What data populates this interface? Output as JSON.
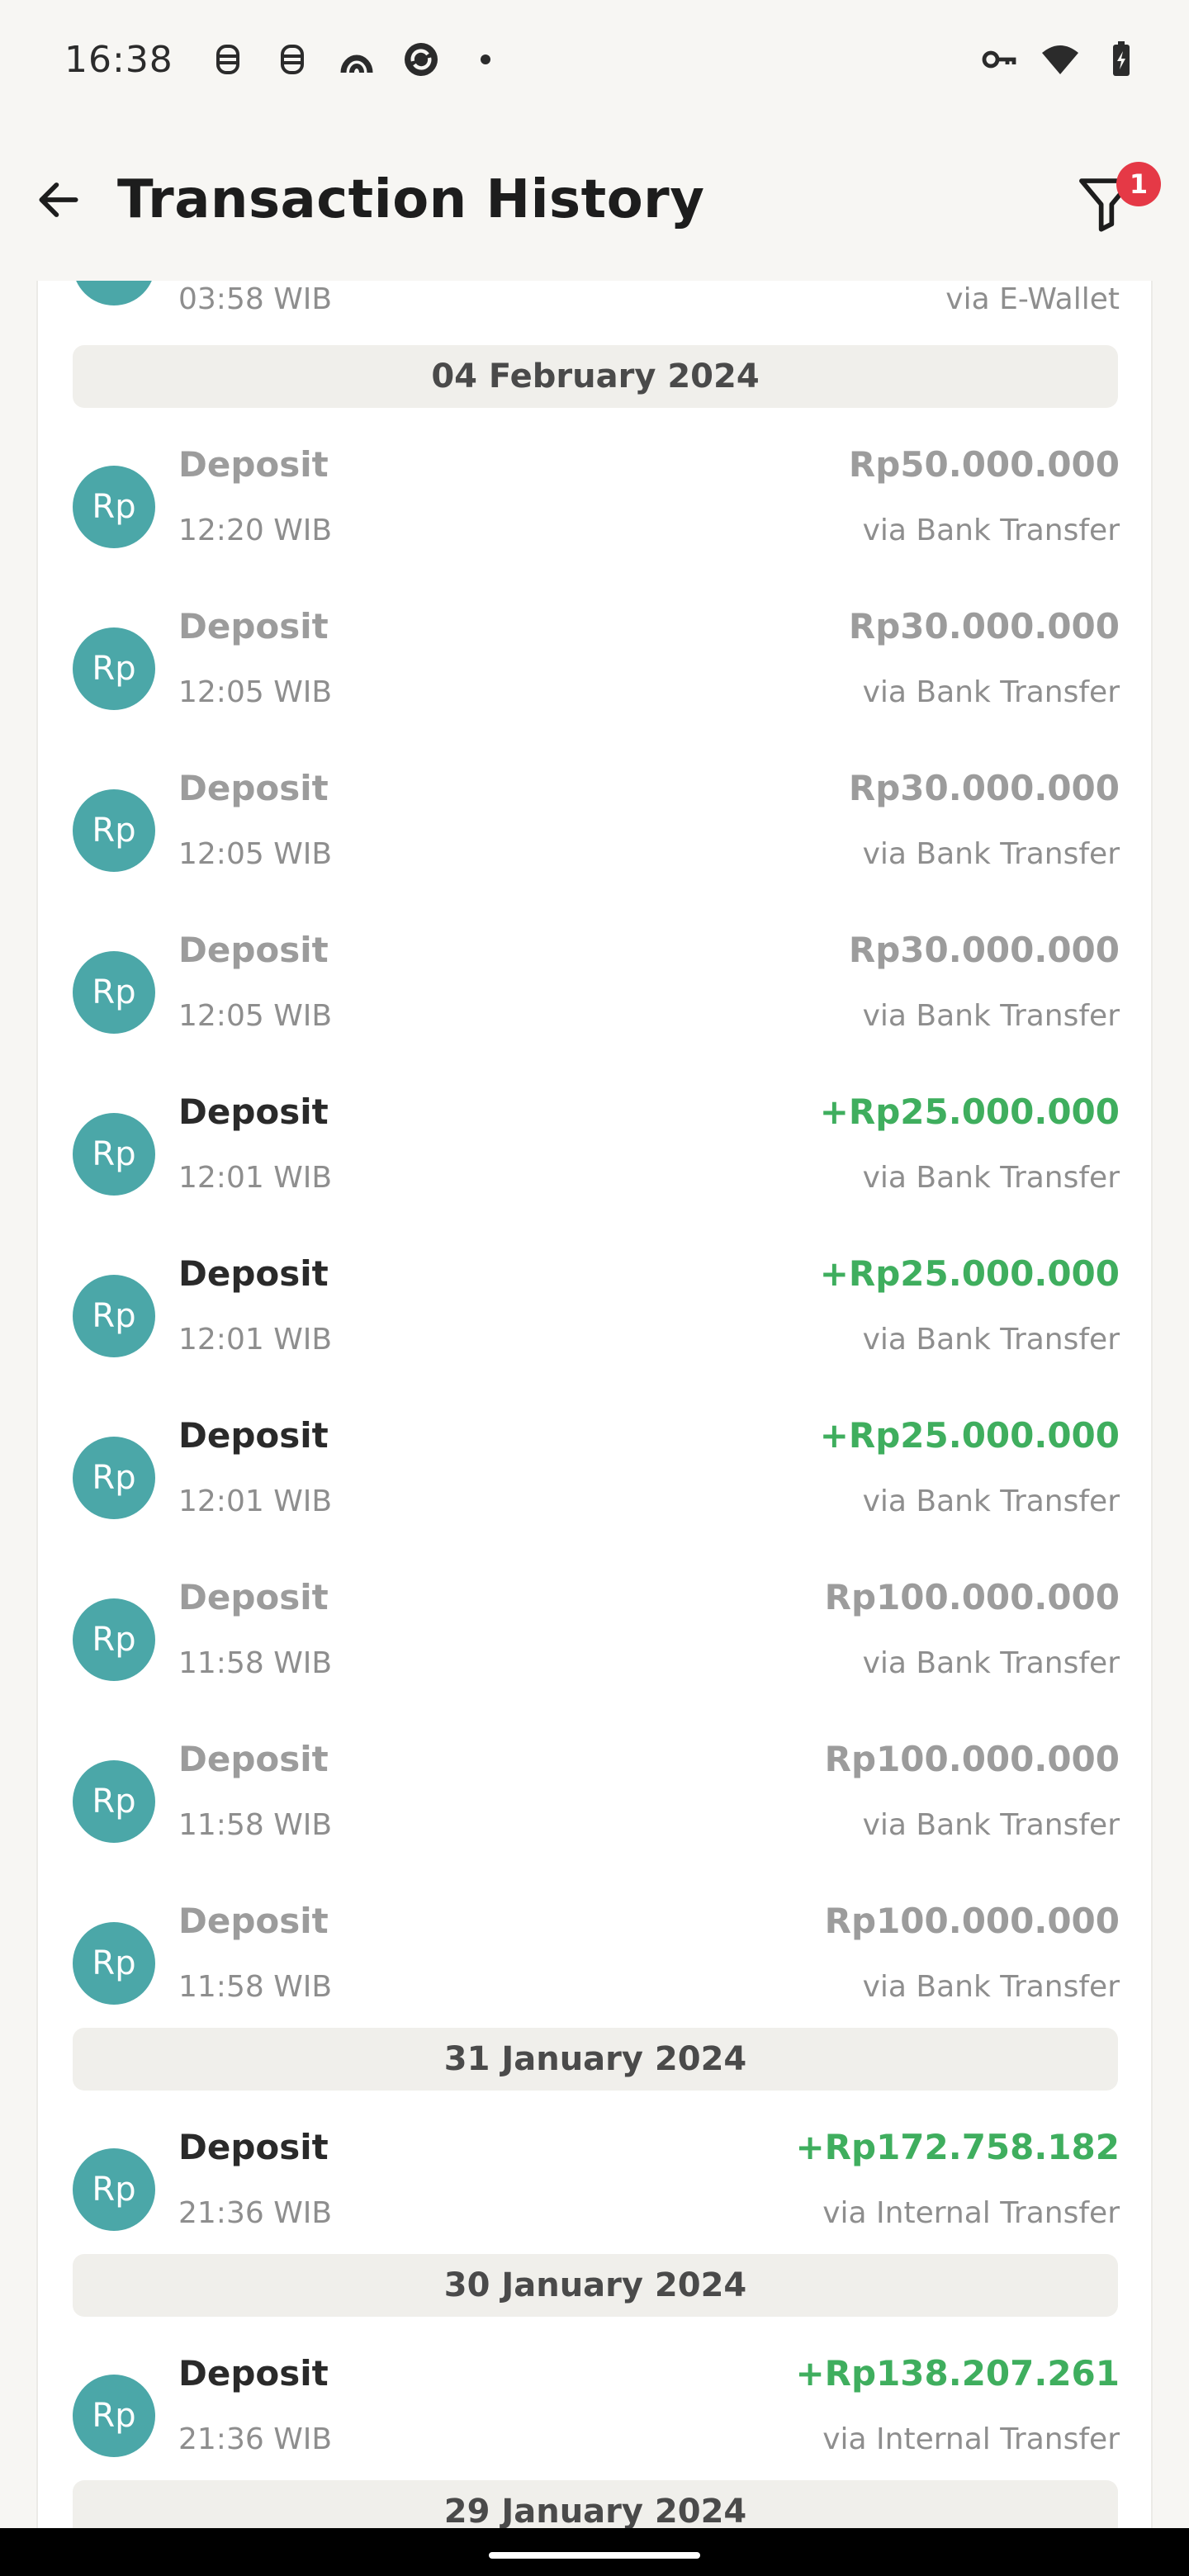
{
  "status_bar": {
    "time": "16:38",
    "left_icons": [
      "face-icon",
      "face-icon",
      "arc-app-icon",
      "refresh-app-icon",
      "dot-icon"
    ],
    "right_icons": [
      "key-icon",
      "wifi-icon",
      "battery-charging-icon"
    ]
  },
  "app_bar": {
    "title": "Transaction History",
    "back_icon": "arrow-left-icon",
    "filter_icon": "filter-icon",
    "filter_badge": "1"
  },
  "partial_row": {
    "time": "03:58 WIB",
    "method": "via E-Wallet"
  },
  "groups": [
    {
      "date": "04 February 2024",
      "items": [
        {
          "avatar": "Rp",
          "type": "Deposit",
          "time": "12:20 WIB",
          "amount": "Rp50.000.000",
          "method": "via Bank Transfer",
          "state": "muted"
        },
        {
          "avatar": "Rp",
          "type": "Deposit",
          "time": "12:05 WIB",
          "amount": "Rp30.000.000",
          "method": "via Bank Transfer",
          "state": "muted"
        },
        {
          "avatar": "Rp",
          "type": "Deposit",
          "time": "12:05 WIB",
          "amount": "Rp30.000.000",
          "method": "via Bank Transfer",
          "state": "muted"
        },
        {
          "avatar": "Rp",
          "type": "Deposit",
          "time": "12:05 WIB",
          "amount": "Rp30.000.000",
          "method": "via Bank Transfer",
          "state": "muted"
        },
        {
          "avatar": "Rp",
          "type": "Deposit",
          "time": "12:01 WIB",
          "amount": "+Rp25.000.000",
          "method": "via Bank Transfer",
          "state": "active"
        },
        {
          "avatar": "Rp",
          "type": "Deposit",
          "time": "12:01 WIB",
          "amount": "+Rp25.000.000",
          "method": "via Bank Transfer",
          "state": "active"
        },
        {
          "avatar": "Rp",
          "type": "Deposit",
          "time": "12:01 WIB",
          "amount": "+Rp25.000.000",
          "method": "via Bank Transfer",
          "state": "active"
        },
        {
          "avatar": "Rp",
          "type": "Deposit",
          "time": "11:58 WIB",
          "amount": "Rp100.000.000",
          "method": "via Bank Transfer",
          "state": "muted"
        },
        {
          "avatar": "Rp",
          "type": "Deposit",
          "time": "11:58 WIB",
          "amount": "Rp100.000.000",
          "method": "via Bank Transfer",
          "state": "muted"
        },
        {
          "avatar": "Rp",
          "type": "Deposit",
          "time": "11:58 WIB",
          "amount": "Rp100.000.000",
          "method": "via Bank Transfer",
          "state": "muted"
        }
      ]
    },
    {
      "date": "31 January 2024",
      "items": [
        {
          "avatar": "Rp",
          "type": "Deposit",
          "time": "21:36 WIB",
          "amount": "+Rp172.758.182",
          "method": "via Internal Transfer",
          "state": "active"
        }
      ]
    },
    {
      "date": "30 January 2024",
      "items": [
        {
          "avatar": "Rp",
          "type": "Deposit",
          "time": "21:36 WIB",
          "amount": "+Rp138.207.261",
          "method": "via Internal Transfer",
          "state": "active"
        }
      ]
    },
    {
      "date": "29 January 2024",
      "items": []
    }
  ],
  "colors": {
    "background": "#F7F6F3",
    "card": "#FFFFFF",
    "avatar": "#4BA7A8",
    "positive_amount": "#3FAE5E",
    "muted_text": "#9C9C9C",
    "badge": "#E53946",
    "date_header_bg": "#F0EFEB"
  }
}
